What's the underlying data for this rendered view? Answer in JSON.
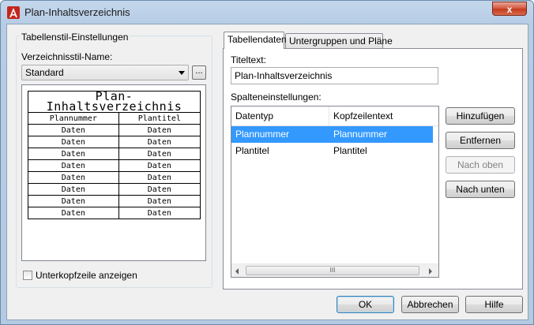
{
  "window": {
    "title": "Plan-Inhaltsverzeichnis",
    "close_glyph": "x"
  },
  "left_group": {
    "caption": "Tabellenstil-Einstellungen",
    "style_name_label": "Verzeichnisstil-Name:",
    "style_selected": "Standard",
    "browse_label": "...",
    "preview": {
      "title": "Plan-Inhaltsverzeichnis",
      "headers": [
        "Plannummer",
        "Plantitel"
      ],
      "rows": [
        [
          "Daten",
          "Daten"
        ],
        [
          "Daten",
          "Daten"
        ],
        [
          "Daten",
          "Daten"
        ],
        [
          "Daten",
          "Daten"
        ],
        [
          "Daten",
          "Daten"
        ],
        [
          "Daten",
          "Daten"
        ],
        [
          "Daten",
          "Daten"
        ],
        [
          "Daten",
          "Daten"
        ]
      ]
    },
    "subheader_checkbox_label": "Unterkopfzeile anzeigen",
    "subheader_checked": false
  },
  "tabs": [
    {
      "label": "Tabellendaten",
      "active": true
    },
    {
      "label": "Untergruppen und Pläne",
      "active": false
    }
  ],
  "table_data": {
    "title_label": "Titeltext:",
    "title_value": "Plan-Inhaltsverzeichnis",
    "columns_label": "Spalteneinstellungen:",
    "list_headers": [
      "Datentyp",
      "Kopfzeilentext"
    ],
    "list_rows": [
      {
        "type": "Plannummer",
        "header": "Plannummer",
        "selected": true
      },
      {
        "type": "Plantitel",
        "header": "Plantitel",
        "selected": false
      }
    ],
    "scroll_thumb_glyph": "III"
  },
  "side_buttons": {
    "add": "Hinzufügen",
    "remove": "Entfernen",
    "move_up": "Nach oben",
    "move_down": "Nach unten"
  },
  "footer_buttons": {
    "ok": "OK",
    "cancel": "Abbrechen",
    "help": "Hilfe"
  }
}
